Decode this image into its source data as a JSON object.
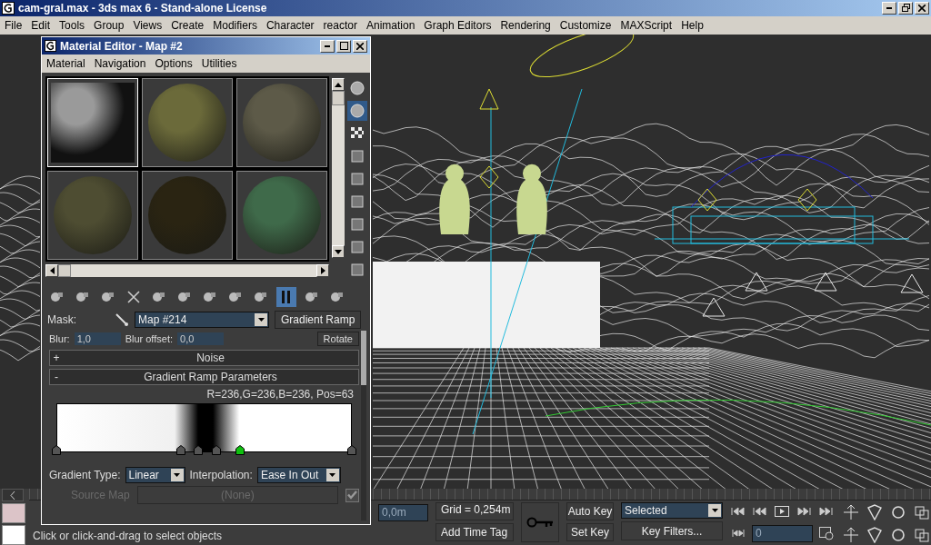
{
  "window": {
    "title": "cam-gral.max - 3ds max 6 - Stand-alone License"
  },
  "menu": [
    "File",
    "Edit",
    "Tools",
    "Group",
    "Views",
    "Create",
    "Modifiers",
    "Character",
    "reactor",
    "Animation",
    "Graph Editors",
    "Rendering",
    "Customize",
    "MAXScript",
    "Help"
  ],
  "material_editor": {
    "title": "Material Editor - Map #2",
    "menu": [
      "Material",
      "Navigation",
      "Options",
      "Utilities"
    ],
    "slots": [
      {
        "kind": "flat",
        "color": "#9a9a9a",
        "selected": true
      },
      {
        "kind": "sphere",
        "color": "#6b6a3a",
        "selected": false
      },
      {
        "kind": "sphere",
        "color": "#5d5a48",
        "selected": false
      },
      {
        "kind": "sphere",
        "color": "#4e4d32",
        "selected": false
      },
      {
        "kind": "sphere",
        "color": "#2a2412",
        "selected": false
      },
      {
        "kind": "sphere",
        "color": "#3f6a4a",
        "selected": false
      }
    ],
    "side_tools": [
      {
        "on": false
      },
      {
        "on": true
      },
      {
        "on": false
      },
      {
        "on": false
      },
      {
        "on": false
      },
      {
        "on": false
      },
      {
        "on": false
      },
      {
        "on": false
      },
      {
        "on": false
      }
    ],
    "toolbar": [
      {
        "on": false
      },
      {
        "on": false
      },
      {
        "on": false
      },
      {
        "on": false
      },
      {
        "on": false
      },
      {
        "on": false
      },
      {
        "on": false
      },
      {
        "on": false
      },
      {
        "on": false
      },
      {
        "on": true
      },
      {
        "on": false
      },
      {
        "on": false
      }
    ],
    "mask_label": "Mask:",
    "map_name": "Map #214",
    "map_type": "Gradient Ramp",
    "blur": {
      "label": "Blur:",
      "value": "1,0",
      "offset_label": "Blur offset:",
      "offset_value": "0,0",
      "button": "Rotate"
    },
    "rollouts": [
      {
        "sign": "+",
        "title": "Noise"
      },
      {
        "sign": "-",
        "title": "Gradient Ramp Parameters"
      }
    ],
    "color_readout": "R=236,G=236,B=236, Pos=63",
    "ramp_flags": [
      {
        "level": 0,
        "selected": false
      },
      {
        "level": 0.42,
        "selected": false
      },
      {
        "level": 0.48,
        "selected": false
      },
      {
        "level": 0.54,
        "selected": false
      },
      {
        "level": 0.62,
        "selected": true
      },
      {
        "level": 1,
        "selected": false
      }
    ],
    "gradient_type": {
      "label": "Gradient Type:",
      "value": "Linear"
    },
    "interpolation": {
      "label": "Interpolation:",
      "value": "Ease In Out"
    },
    "source_map": {
      "label": "Source Map",
      "value": "(None)",
      "disabled": true,
      "checked": true
    }
  },
  "bottom": {
    "status": "Click or click-and-drag to select objects",
    "coord": "0,0m",
    "grid": "Grid = 0,254m",
    "add_tag": "Add Time Tag",
    "auto_key": "Auto Key",
    "set_key": "Set Key",
    "key_mode": "Selected",
    "key_filters": "Key Filters...",
    "frame": "0"
  }
}
